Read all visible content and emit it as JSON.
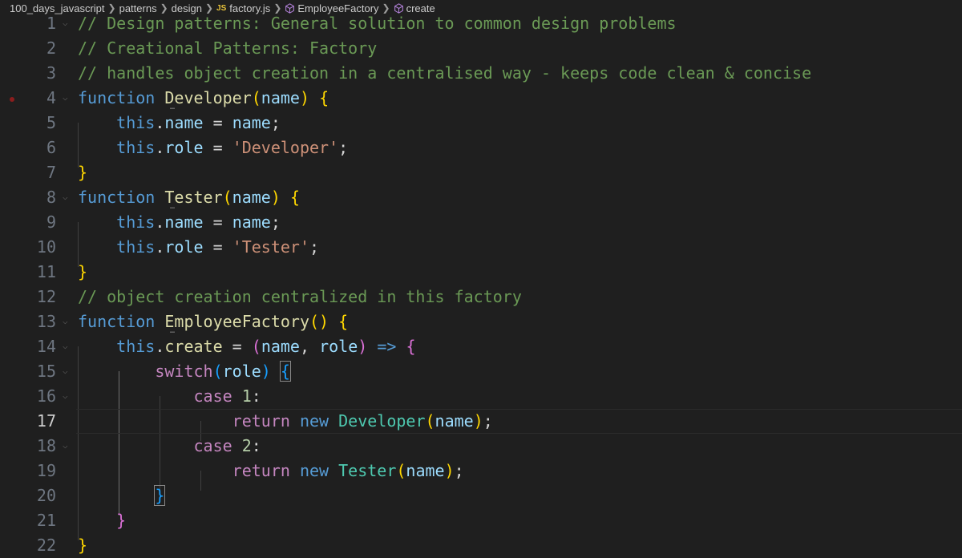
{
  "breadcrumb": {
    "folder1": "100_days_javascript",
    "folder2": "patterns",
    "folder3": "design",
    "file_badge": "JS",
    "file": "factory.js",
    "symbol1": "EmployeeFactory",
    "symbol2": "create"
  },
  "editor": {
    "current_line": 17,
    "lines": [
      {
        "num": "1"
      },
      {
        "num": "2"
      },
      {
        "num": "3"
      },
      {
        "num": "4"
      },
      {
        "num": "5"
      },
      {
        "num": "6"
      },
      {
        "num": "7"
      },
      {
        "num": "8"
      },
      {
        "num": "9"
      },
      {
        "num": "10"
      },
      {
        "num": "11"
      },
      {
        "num": "12"
      },
      {
        "num": "13"
      },
      {
        "num": "14"
      },
      {
        "num": "15"
      },
      {
        "num": "16"
      },
      {
        "num": "17"
      },
      {
        "num": "18"
      },
      {
        "num": "19"
      },
      {
        "num": "20"
      },
      {
        "num": "21"
      },
      {
        "num": "22"
      }
    ],
    "tokens": {
      "l1": "// Design patterns: General solution to common design problems",
      "l2": "// Creational Patterns: Factory",
      "l3": "// handles object creation in a centralised way - keeps code clean & concise",
      "kw_function": "function",
      "developer": "Developer",
      "tester": "Tester",
      "employee_factory": "EmployeeFactory",
      "name": "name",
      "role": "role",
      "this": "this",
      "create": "create",
      "str_developer": "'Developer'",
      "str_tester": "'Tester'",
      "l12": "// object creation centralized in this factory",
      "switch": "switch",
      "case": "case",
      "return": "return",
      "new": "new",
      "num1": "1",
      "num2": "2"
    }
  }
}
